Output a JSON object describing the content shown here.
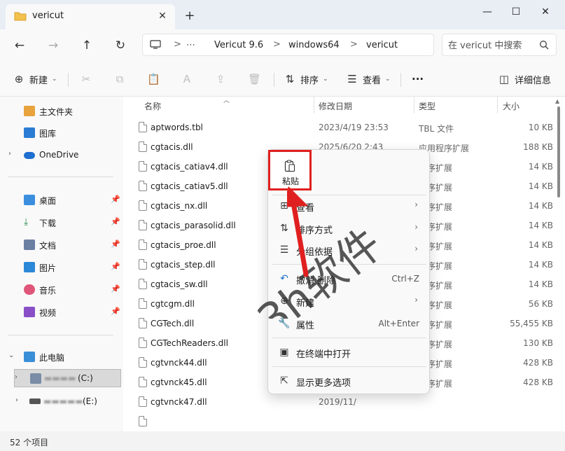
{
  "window": {
    "tab_title": "vericut",
    "tab_close": "✕",
    "new_tab": "+",
    "minimize": "—",
    "maximize": "☐",
    "close": "✕"
  },
  "nav": {
    "back": "←",
    "forward": "→",
    "up": "↑",
    "refresh": "↻"
  },
  "address": {
    "crumbs": [
      "Vericut 9.6",
      "windows64",
      "vericut"
    ],
    "sep": ">",
    "more": "⋯",
    "chev": ">"
  },
  "search": {
    "placeholder": "在 vericut 中搜索"
  },
  "toolbar": {
    "new_label": "新建",
    "sort_label": "排序",
    "view_label": "查看",
    "more": "···",
    "details_label": "详细信息",
    "caret": "⌄"
  },
  "sidebar": {
    "items": [
      {
        "label": "主文件夹"
      },
      {
        "label": "图库"
      },
      {
        "label": "OneDrive"
      },
      {
        "label": "桌面"
      },
      {
        "label": "下载"
      },
      {
        "label": "文档"
      },
      {
        "label": "图片"
      },
      {
        "label": "音乐"
      },
      {
        "label": "视频"
      },
      {
        "label": "此电脑"
      },
      {
        "label": "(C:)"
      },
      {
        "label": "(E:)"
      }
    ],
    "pin": "📌",
    "chev_right": "›",
    "chev_down": "⌄"
  },
  "columns": {
    "name": "名称",
    "date": "修改日期",
    "type": "类型",
    "size": "大小"
  },
  "files": [
    {
      "name": "aptwords.tbl",
      "date": "2023/4/19 23:53",
      "type": "TBL 文件",
      "size": "10 KB"
    },
    {
      "name": "cgtacis.dll",
      "date": "2025/6/20 2:43",
      "type": "应用程序扩展",
      "size": "188 KB"
    },
    {
      "name": "cgtacis_catiav4.dll",
      "date": "",
      "type": "程序扩展",
      "size": "14 KB"
    },
    {
      "name": "cgtacis_catiav5.dll",
      "date": "",
      "type": "程序扩展",
      "size": "14 KB"
    },
    {
      "name": "cgtacis_nx.dll",
      "date": "",
      "type": "程序扩展",
      "size": "14 KB"
    },
    {
      "name": "cgtacis_parasolid.dll",
      "date": "",
      "type": "程序扩展",
      "size": "14 KB"
    },
    {
      "name": "cgtacis_proe.dll",
      "date": "",
      "type": "程序扩展",
      "size": "14 KB"
    },
    {
      "name": "cgtacis_step.dll",
      "date": "",
      "type": "程序扩展",
      "size": "14 KB"
    },
    {
      "name": "cgtacis_sw.dll",
      "date": "",
      "type": "程序扩展",
      "size": "14 KB"
    },
    {
      "name": "cgtcgm.dll",
      "date": "",
      "type": "程序扩展",
      "size": "56 KB"
    },
    {
      "name": "CGTech.dll",
      "date": "",
      "type": "程序扩展",
      "size": "55,455 KB"
    },
    {
      "name": "CGTechReaders.dll",
      "date": "",
      "type": "程序扩展",
      "size": "130 KB"
    },
    {
      "name": "cgtvnck44.dll",
      "date": "",
      "type": "程序扩展",
      "size": "428 KB"
    },
    {
      "name": "cgtvnck45.dll",
      "date": "",
      "type": "程序扩展",
      "size": "428 KB"
    },
    {
      "name": "cgtvnck47.dll",
      "date": "2019/11/",
      "type": "",
      "size": ""
    }
  ],
  "status": {
    "count": "52 个项目"
  },
  "context_menu": {
    "paste": "粘贴",
    "items": [
      {
        "label": "查看",
        "icon": "grid-icon",
        "glyph": "⊞",
        "arrow": "›"
      },
      {
        "label": "排序方式",
        "icon": "sort-icon",
        "glyph": "⇅",
        "arrow": "›"
      },
      {
        "label": "分组依据",
        "icon": "group-icon",
        "glyph": "☰",
        "arrow": "›"
      },
      {
        "label": "撤消 删除",
        "icon": "undo-icon",
        "glyph": "↶",
        "shortcut": "Ctrl+Z"
      },
      {
        "label": "新建",
        "icon": "new-icon",
        "glyph": "⊕",
        "arrow": "›"
      },
      {
        "label": "属性",
        "icon": "properties-icon",
        "glyph": "🔧",
        "shortcut": "Alt+Enter"
      },
      {
        "label": "在终端中打开",
        "icon": "terminal-icon",
        "glyph": "▣"
      },
      {
        "label": "显示更多选项",
        "icon": "more-options-icon",
        "glyph": "⇱"
      }
    ]
  },
  "watermark": "3h软件",
  "colors": {
    "accent": "#0067c0",
    "highlight_border": "#e02020",
    "arrow": "#e02020",
    "folder": "#f2c14e"
  }
}
